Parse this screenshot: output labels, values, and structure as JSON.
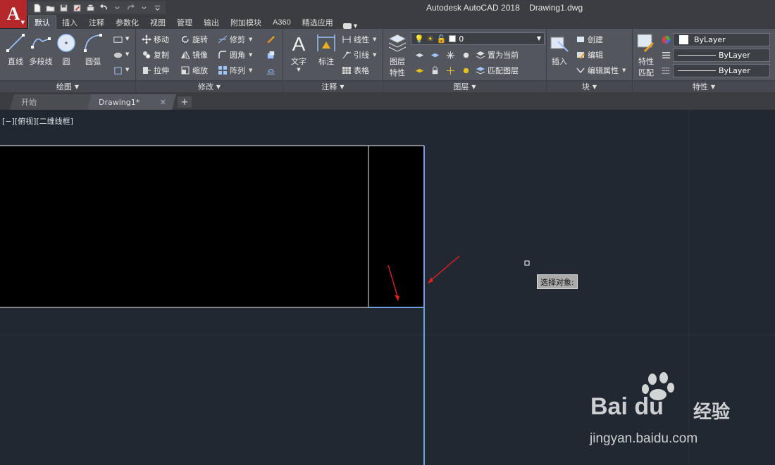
{
  "titlebar": {
    "title": "Autodesk AutoCAD 2018    Drawing1.dwg",
    "app_logo": "A",
    "qat_icons": [
      "new-file-icon",
      "open-folder-icon",
      "save-icon",
      "save-as-icon",
      "plot-icon",
      "undo-icon",
      "redo-icon",
      "customize-qat-icon"
    ]
  },
  "ribbon": {
    "tabs": [
      "默认",
      "插入",
      "注释",
      "参数化",
      "视图",
      "管理",
      "输出",
      "附加模块",
      "A360",
      "精选应用"
    ],
    "active_tab": "默认",
    "panels": {
      "draw": {
        "title": "绘图",
        "buttons": [
          "直线",
          "多段线",
          "圆",
          "圆弧"
        ]
      },
      "modify": {
        "title": "修改",
        "buttons": [
          "移动",
          "旋转",
          "修剪",
          "复制",
          "镜像",
          "圆角",
          "拉伸",
          "缩放",
          "阵列"
        ]
      },
      "annotation": {
        "title": "注释",
        "buttons": [
          "文字",
          "标注",
          "线性",
          "引线",
          "表格"
        ]
      },
      "layers": {
        "title": "图层",
        "button": "图层特性",
        "button_line1": "图层",
        "button_line2": "特性",
        "current_layer": "0",
        "buttons": [
          "置为当前",
          "匹配图层"
        ]
      },
      "block": {
        "title": "块",
        "buttons": [
          "插入",
          "创建",
          "编辑",
          "编辑属性"
        ]
      },
      "properties": {
        "title": "特性",
        "button_line1": "特性",
        "button_line2": "匹配",
        "color": "ByLayer",
        "linetype": "ByLayer",
        "lineweight": "ByLayer"
      }
    }
  },
  "filetabs": {
    "tabs": [
      "开始",
      "Drawing1*"
    ],
    "close": "✕",
    "add": "+"
  },
  "canvas": {
    "view_label": "[−][俯视][二维线框]",
    "tooltip": "选择对象:",
    "colors": {
      "background": "#212832",
      "selected_line": "#5b8fd8",
      "white_line": "#d8d8d8",
      "arrow": "#e02020"
    }
  },
  "watermark": {
    "logo": "Bai du",
    "brand_cn": "经验",
    "url": "jingyan.baidu.com"
  }
}
